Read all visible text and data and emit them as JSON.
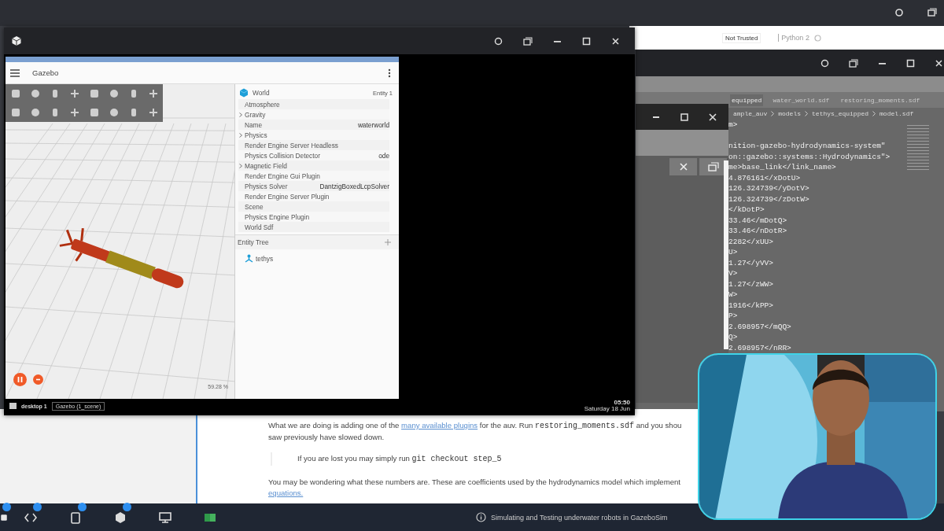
{
  "notebook_bar": {
    "trust": "Not Trusted",
    "kernel": "Python 2"
  },
  "editor": {
    "tabs": [
      {
        "label": "equipped",
        "selected": true
      },
      {
        "label": "water_world.sdf",
        "selected": false
      },
      {
        "label": "restoring_moments.sdf",
        "selected": false
      }
    ],
    "breadcrumb": [
      "ample_auv",
      "models",
      "tethys_equipped",
      "model.sdf"
    ],
    "code_lines": [
      "m>",
      "nition-gazebo-hydrodynamics-system\"",
      "on::gazebo::systems::Hydrodynamics\">",
      "me>base_link</link_name>",
      "4.876161</xDotU>",
      "126.324739</yDotV>",
      "126.324739</zDotW>",
      "</kDotP>",
      "33.46</mDotQ>",
      "33.46</nDotR>",
      "2282</xUU>",
      "U>",
      "1.27</yVV>",
      "V>",
      "1.27</zWW>",
      "W>",
      "1916</kPP>",
      "P>",
      "2.698957</mQQ>",
      "Q>",
      "2.698957</nRR>"
    ]
  },
  "gazebo": {
    "title": "Gazebo",
    "inspector": {
      "title": "World",
      "entity": "Entity 1",
      "rows": [
        {
          "label": "Atmosphere",
          "expandable": false
        },
        {
          "label": "Gravity",
          "expandable": true
        },
        {
          "label": "Name",
          "value": "waterworld",
          "expandable": false
        },
        {
          "label": "Physics",
          "expandable": true
        },
        {
          "label": "Render Engine Server Headless",
          "expandable": false
        },
        {
          "label": "Physics Collision Detector",
          "value": "ode",
          "expandable": false
        },
        {
          "label": "Magnetic Field",
          "expandable": true
        },
        {
          "label": "Render Engine Gui Plugin",
          "expandable": false
        },
        {
          "label": "Physics Solver",
          "value": "DantzigBoxedLcpSolver",
          "expandable": false
        },
        {
          "label": "Render Engine Server Plugin",
          "expandable": false
        },
        {
          "label": "Scene",
          "expandable": false
        },
        {
          "label": "Physics Engine Plugin",
          "expandable": false
        },
        {
          "label": "World Sdf",
          "expandable": false
        }
      ]
    },
    "entity_tree": {
      "title": "Entity Tree",
      "items": [
        {
          "label": "tethys"
        }
      ]
    },
    "rtf": "59.28 %",
    "paused": false
  },
  "vnc_taskbar": {
    "desktop": "desktop 1",
    "task": "Gazebo (1_scene)",
    "time": "05:50",
    "date": "Saturday 18 Jun"
  },
  "page": {
    "p1": {
      "before": "What we are doing is adding one of the ",
      "link": "many available plugins",
      "mid": " for the auv. Run ",
      "code": "restoring_moments.sdf",
      "after": " and you shou"
    },
    "p1_line2": "saw previously have slowed down.",
    "quote": {
      "text": "If you are lost you may simply run ",
      "code": "git checkout step_5"
    },
    "p3": "You may be wondering what these numbers are. These are coefficients used by the hydrodynamics model which implement",
    "p3_link": "equations."
  },
  "taskbar": {
    "apps": [
      {
        "kind": "files",
        "badge": true
      },
      {
        "kind": "code",
        "badge": true
      },
      {
        "kind": "clipboard",
        "badge": true
      },
      {
        "kind": "package",
        "badge": true
      },
      {
        "kind": "monitor",
        "badge": false
      },
      {
        "kind": "terminal",
        "badge": false
      }
    ],
    "title": "Simulating and Testing underwater robots in GazeboSim"
  }
}
